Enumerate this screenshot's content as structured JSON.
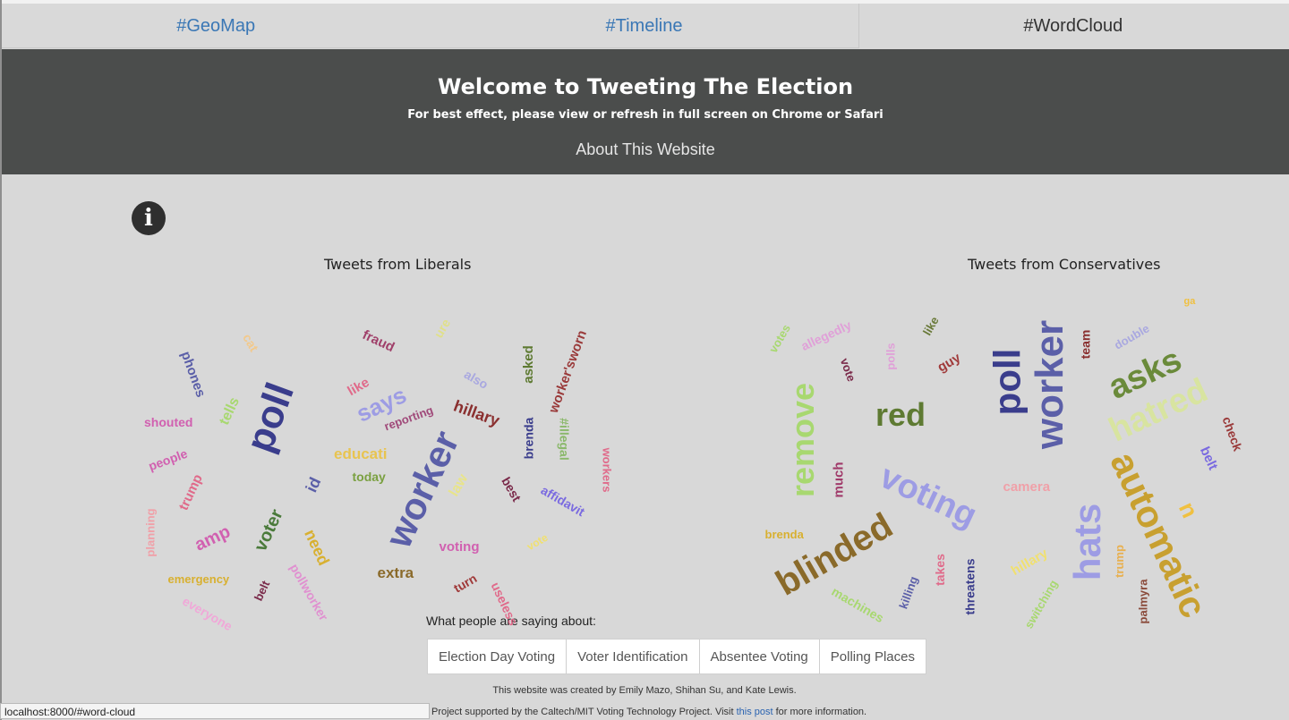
{
  "nav": {
    "items": [
      {
        "label": "#GeoMap",
        "active": false
      },
      {
        "label": "#Timeline",
        "active": false
      },
      {
        "label": "#WordCloud",
        "active": true
      }
    ]
  },
  "hero": {
    "title": "Welcome to Tweeting The Election",
    "subtitle": "For best effect, please view or refresh in full screen on Chrome or Safari",
    "about_link": "About This Website"
  },
  "info_icon": "info-circle-icon",
  "clouds": {
    "liberal_title": "Tweets from Liberals",
    "conservative_title": "Tweets from Conservatives",
    "liberal_words": [
      "cat",
      "fraud",
      "ure",
      "phones",
      "like",
      "also",
      "asked",
      "worker'sworn",
      "says",
      "tells",
      "poll",
      "shouted",
      "reporting",
      "hillary",
      "brenda",
      "#illegal",
      "educati",
      "people",
      "today",
      "worker",
      "law",
      "id",
      "best",
      "workers",
      "trump",
      "affidavit",
      "planning",
      "voter",
      "amp",
      "need",
      "voting",
      "vote",
      "emergency",
      "extra",
      "turn",
      "belt",
      "pollworker",
      "everyone",
      "useless"
    ],
    "conservative_words": [
      "votes",
      "allegedly",
      "polls",
      "like",
      "team",
      "double",
      "vote",
      "guy",
      "poll",
      "worker",
      "asks",
      "remove",
      "red",
      "hatred",
      "check",
      "much",
      "voting",
      "camera",
      "belt",
      "n",
      "automatic",
      "brenda",
      "blinded",
      "hats",
      "trump",
      "hillary",
      "takes",
      "threatens",
      "switching",
      "palmyra",
      "machines",
      "ga",
      "killing"
    ]
  },
  "issues": {
    "prompt": "What people are saying about:",
    "buttons": [
      "Election Day Voting",
      "Voter Identification",
      "Absentee Voting",
      "Polling Places"
    ]
  },
  "footer": {
    "credit": "This website was created by Emily Mazo, Shihan Su, and Kate Lewis.",
    "support_pre": "Project supported by the Caltech/MIT Voting Technology Project. Visit",
    "support_link": "this post",
    "support_post": "for more information."
  },
  "status_url": "localhost:8000/#word-cloud",
  "colors": {
    "hero_bg": "#4b4d4c",
    "page_bg": "#d8d8d8",
    "nav_link": "#3a77b5"
  }
}
